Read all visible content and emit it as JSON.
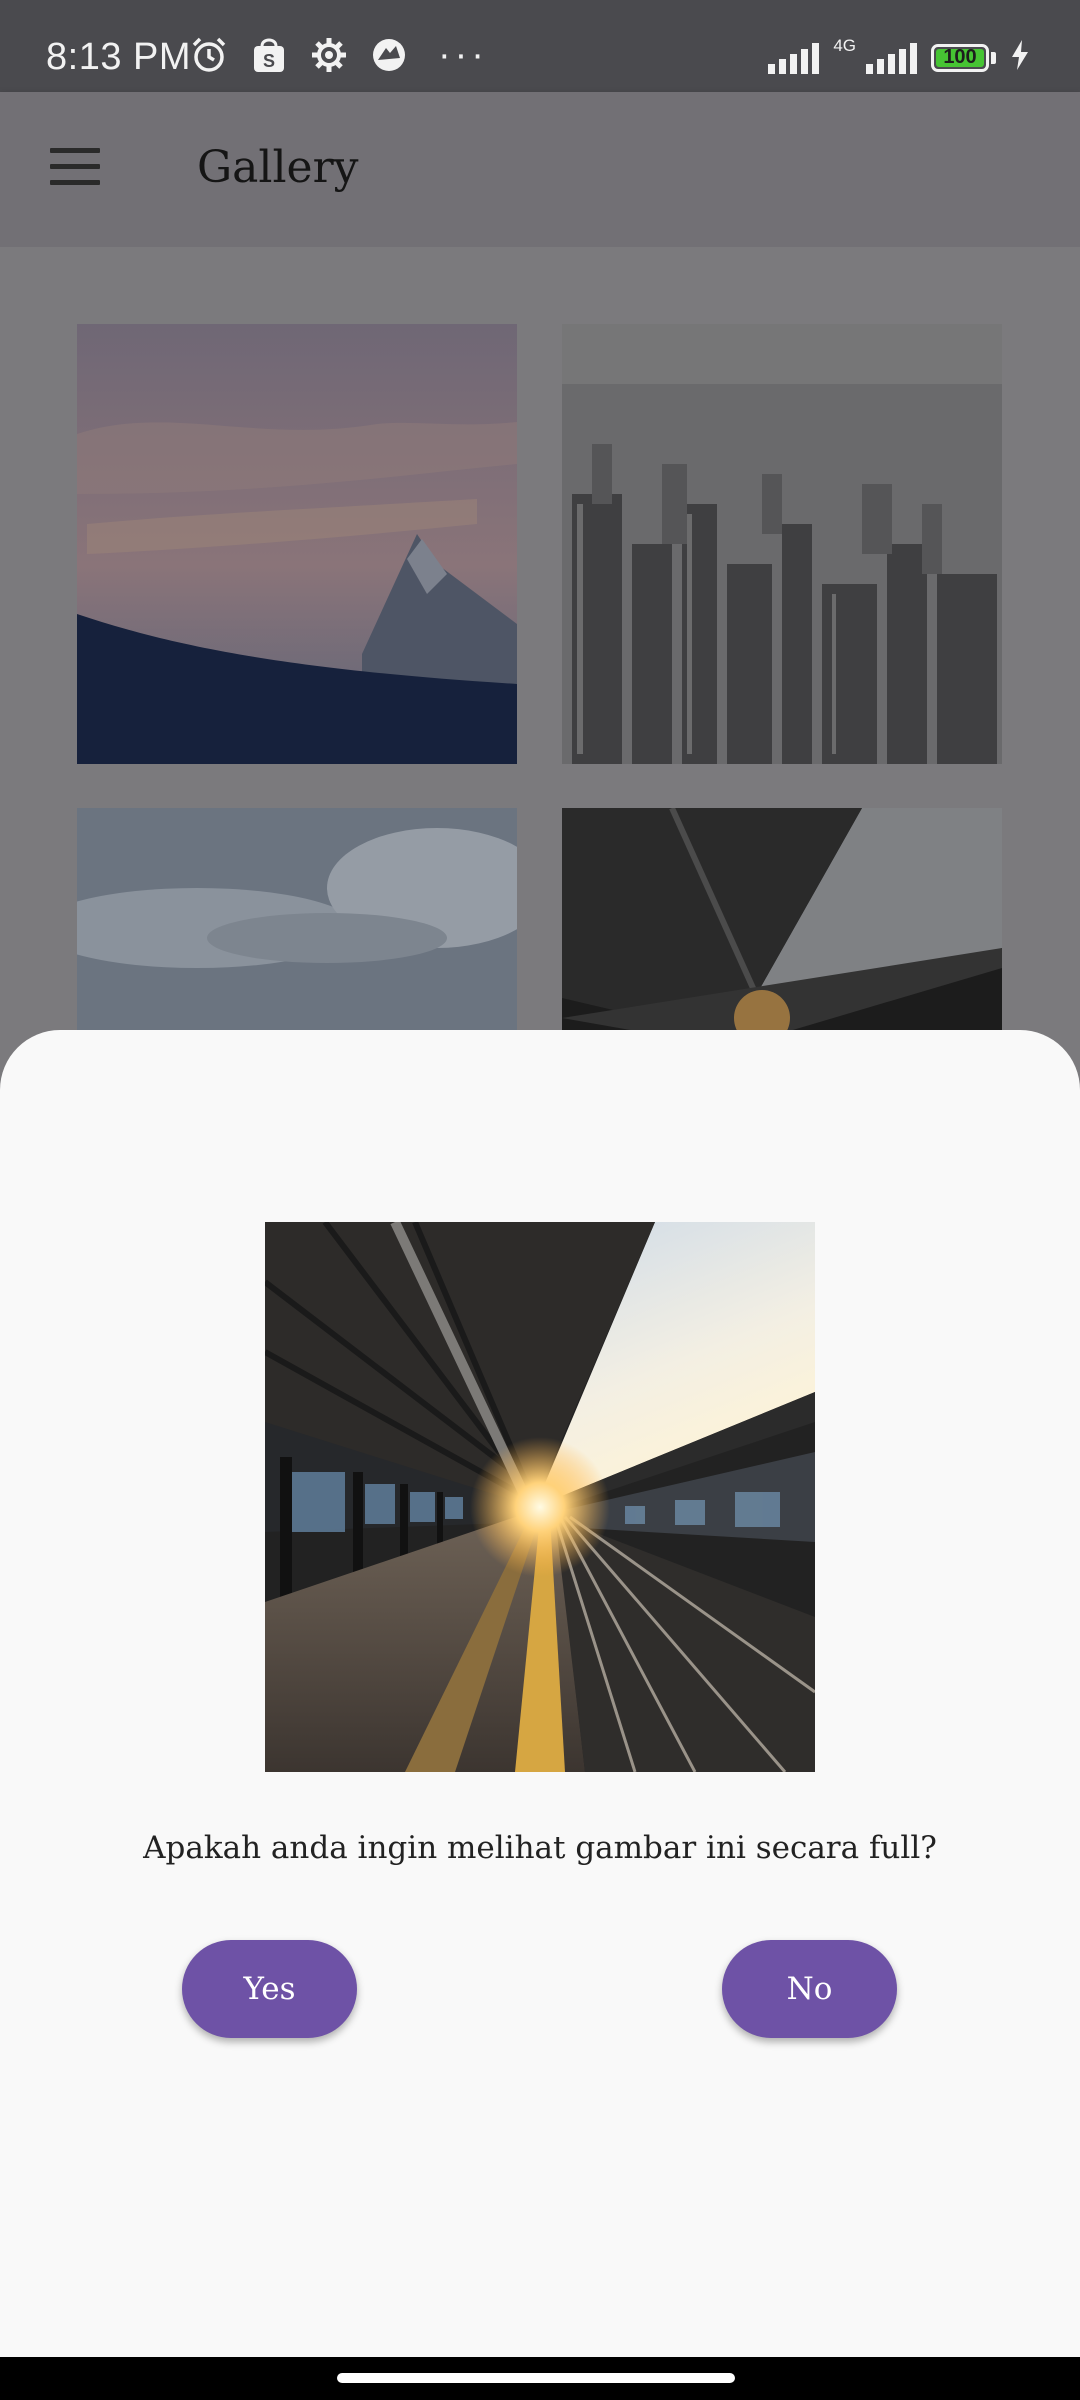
{
  "status_bar": {
    "time": "8:13 PM",
    "icons": [
      "alarm-icon",
      "shopee-icon",
      "settings-icon",
      "jurassic-icon"
    ],
    "more": "···",
    "network": "4G",
    "battery": "100",
    "battery_color": "#46c433"
  },
  "app_bar": {
    "menu_icon": "hamburger-menu-icon",
    "title": "Gallery"
  },
  "gallery": {
    "images": [
      {
        "subject": "mountain-peak"
      },
      {
        "subject": "city-skyline"
      },
      {
        "subject": "clouds"
      },
      {
        "subject": "train-platform"
      }
    ]
  },
  "dialog": {
    "question": "Apakah anda ingin melihat gambar ini secara full?",
    "yes_label": "Yes",
    "no_label": "No",
    "button_color": "#6e52a6"
  }
}
